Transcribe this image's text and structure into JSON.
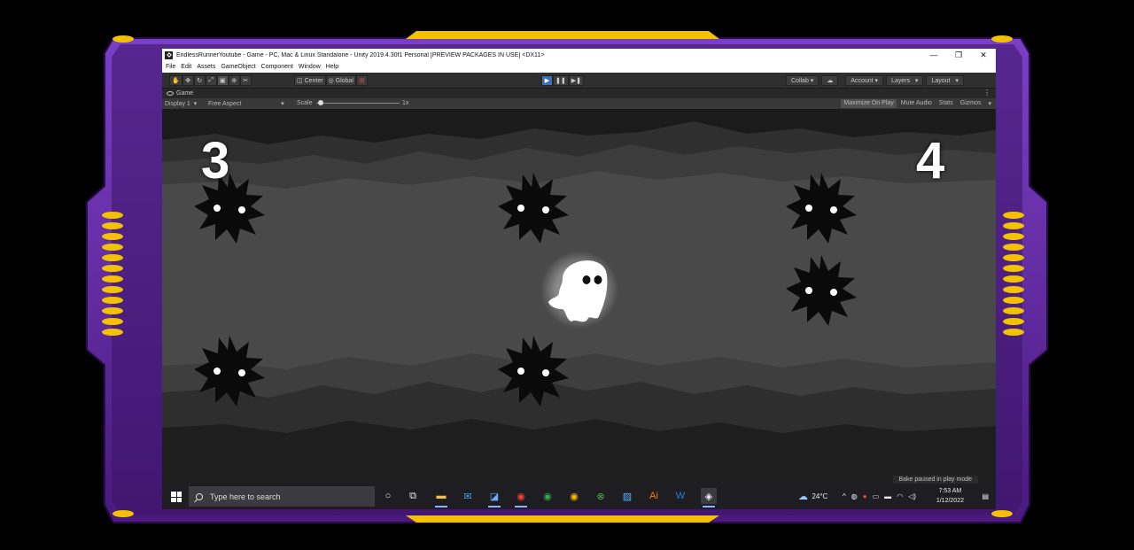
{
  "window": {
    "title": "EndlessRunnerYoutube - Game - PC, Mac & Linux Standalone - Unity 2019.4.30f1 Personal [PREVIEW PACKAGES IN USE] <DX11>",
    "minimize": "—",
    "maximize": "❐",
    "close": "✕"
  },
  "menu": [
    "File",
    "Edit",
    "Assets",
    "GameObject",
    "Component",
    "Window",
    "Help"
  ],
  "toolbar": {
    "tools": [
      "hand-tool",
      "move-tool",
      "rotate-tool",
      "scale-tool",
      "rect-tool",
      "transform-tool",
      "custom-tool"
    ],
    "pivot": "Center",
    "space": "Global",
    "play_state": "playing",
    "collab": "Collab ▾",
    "account": "Account",
    "layers": "Layers",
    "layout": "Layout"
  },
  "tab": {
    "label": "Game"
  },
  "gamebar": {
    "display": "Display 1",
    "aspect": "Free Aspect",
    "scale_label": "Scale",
    "scale_value": "1x",
    "maximize": "Maximize On Play",
    "mute": "Mute Audio",
    "stats": "Stats",
    "gizmos": "Gizmos"
  },
  "game": {
    "score_left": "3",
    "score_right": "4",
    "enemies": [
      "spiky-enemy",
      "spiky-enemy",
      "spiky-enemy",
      "spiky-enemy",
      "spiky-enemy",
      "spiky-enemy"
    ],
    "player": "ghost-player"
  },
  "status": {
    "bake": "Bake paused in play mode"
  },
  "taskbar": {
    "search_placeholder": "Type here to search",
    "weather": "24°C",
    "time": "7:53 AM",
    "date": "1/12/2022"
  },
  "colors": {
    "frame_purple": "#5a2494",
    "frame_gold": "#f2c200",
    "play_blue": "#3a72b0"
  }
}
